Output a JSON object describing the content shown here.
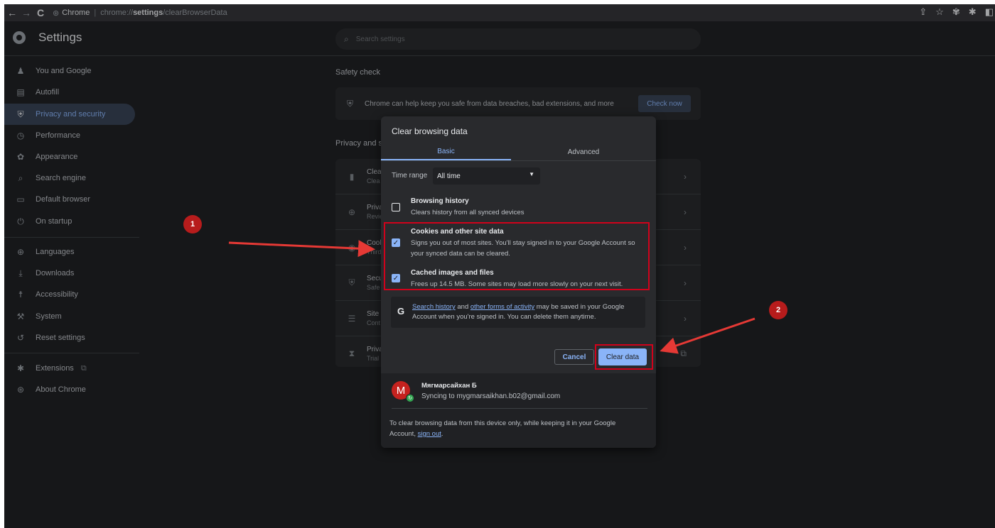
{
  "browser": {
    "site_label": "Chrome",
    "url_prefix": "chrome://",
    "url_bold": "settings",
    "url_suffix": "/clearBrowserData"
  },
  "header": {
    "title": "Settings",
    "search_placeholder": "Search settings"
  },
  "sidebar": {
    "items": [
      {
        "label": "You and Google",
        "icon": "person-icon"
      },
      {
        "label": "Autofill",
        "icon": "clipboard-icon"
      },
      {
        "label": "Privacy and security",
        "icon": "shield-icon",
        "active": true
      },
      {
        "label": "Performance",
        "icon": "speedometer-icon"
      },
      {
        "label": "Appearance",
        "icon": "palette-icon"
      },
      {
        "label": "Search engine",
        "icon": "search-icon"
      },
      {
        "label": "Default browser",
        "icon": "browser-icon"
      },
      {
        "label": "On startup",
        "icon": "power-icon"
      },
      {
        "label": "Languages",
        "icon": "globe-icon"
      },
      {
        "label": "Downloads",
        "icon": "download-icon"
      },
      {
        "label": "Accessibility",
        "icon": "accessibility-icon"
      },
      {
        "label": "System",
        "icon": "wrench-icon"
      },
      {
        "label": "Reset settings",
        "icon": "reset-icon"
      },
      {
        "label": "Extensions",
        "icon": "puzzle-icon"
      },
      {
        "label": "About Chrome",
        "icon": "chrome-icon"
      }
    ]
  },
  "main": {
    "safety_title": "Safety check",
    "safety_text": "Chrome can help keep you safe from data breaches, bad extensions, and more",
    "check_now": "Check now",
    "privacy_title": "Privacy and s",
    "rows": [
      {
        "title": "Clear",
        "sub": "Clea"
      },
      {
        "title": "Priva",
        "sub": "Revie"
      },
      {
        "title": "Cook",
        "sub": "Third"
      },
      {
        "title": "Secu",
        "sub": "Safe"
      },
      {
        "title": "Site s",
        "sub": "Cont"
      },
      {
        "title": "Priva",
        "sub": "Trial"
      }
    ]
  },
  "dialog": {
    "title": "Clear browsing data",
    "tab_basic": "Basic",
    "tab_advanced": "Advanced",
    "time_range_label": "Time range",
    "time_range_value": "All time",
    "options": [
      {
        "title": "Browsing history",
        "desc": "Clears history from all synced devices",
        "checked": false
      },
      {
        "title": "Cookies and other site data",
        "desc": "Signs you out of most sites. You'll stay signed in to your Google Account so your synced data can be cleared.",
        "checked": true
      },
      {
        "title": "Cached images and files",
        "desc": "Frees up 14.5 MB. Some sites may load more slowly on your next visit.",
        "checked": true
      }
    ],
    "google_note": {
      "link1": "Search history",
      "and": " and ",
      "link2": "other forms of activity",
      "rest": " may be saved in your Google Account when you're signed in. You can delete them anytime."
    },
    "cancel": "Cancel",
    "clear": "Clear data",
    "account": {
      "initial": "M",
      "name": "Мягмарсайхан Б",
      "sync": "Syncing to mygmarsaikhan.b02@gmail.com"
    },
    "footer_text": "To clear browsing data from this device only, while keeping it in your Google Account, ",
    "footer_link": "sign out",
    "footer_end": "."
  },
  "annotations": {
    "badge1": "1",
    "badge2": "2",
    "color": "#d0021b"
  }
}
